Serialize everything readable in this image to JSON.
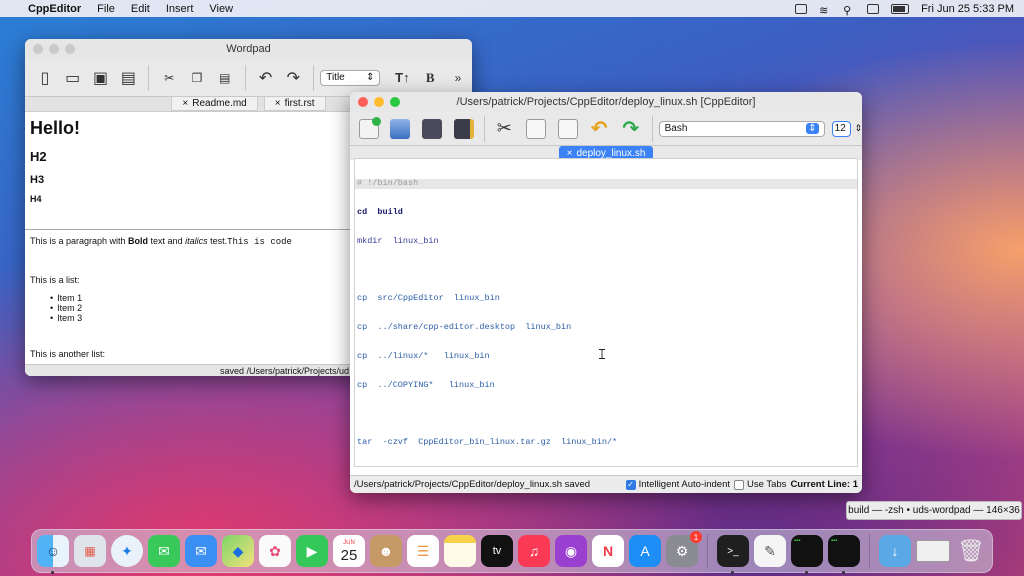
{
  "menubar": {
    "app_name": "CppEditor",
    "items": [
      "File",
      "Edit",
      "Insert",
      "View"
    ],
    "clock": "Fri Jun 25  5:33 PM"
  },
  "wordpad": {
    "title": "Wordpad",
    "style_select": "Title",
    "tabs": [
      "Readme.md",
      "first.rst"
    ],
    "headings": {
      "h1": "Hello!",
      "h2": "H2",
      "h3": "H3",
      "h4": "H4"
    },
    "paragraph": {
      "p1": "This is a paragraph with ",
      "bold": "Bold",
      "p2": " text and ",
      "italic": "italics",
      "p3": " test.",
      "code": "This is code"
    },
    "list_intro": "This is a list:",
    "list_items": [
      "Item 1",
      "Item 2",
      "Item 3"
    ],
    "another_list": "This is another list:",
    "status": "saved  /Users/patrick/Projects/ud"
  },
  "cppeditor": {
    "title": "/Users/patrick/Projects/CppEditor/deploy_linux.sh [CppEditor]",
    "language": "Bash",
    "font_size": "12",
    "tab": "deploy_linux.sh",
    "code_lines": [
      "# !/bin/bash",
      "cd  build",
      "mkdir  linux_bin",
      "",
      "cp  src/CppEditor  linux_bin",
      "cp  ../share/cpp-editor.desktop  linux_bin",
      "cp  ../linux/*   linux_bin",
      "cp  ../COPYING*   linux_bin",
      "",
      "tar  -czvf  CppEditor_bin_linux.tar.gz  linux_bin/*"
    ],
    "status_path": "/Users/patrick/Projects/CppEditor/deploy_linux.sh  saved",
    "auto_indent_label": "Intelligent Auto-indent",
    "auto_indent": true,
    "use_tabs_label": "Use Tabs",
    "use_tabs": false,
    "current_line": "Current Line: 1"
  },
  "dock": {
    "calendar_month": "JUN",
    "calendar_day": "25",
    "settings_badge": "1",
    "tooltip": "build — -zsh • uds-wordpad — 146×36"
  }
}
